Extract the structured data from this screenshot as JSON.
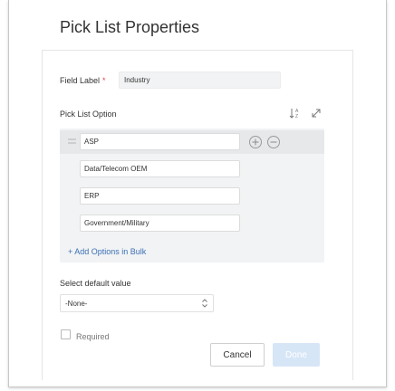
{
  "dialog": {
    "title": "Pick List Properties"
  },
  "field_label": {
    "label": "Field Label",
    "required_marker": "*",
    "value": "Industry"
  },
  "pick_list": {
    "label": "Pick List Option",
    "sort_icon": "sort-alpha-icon",
    "expand_icon": "expand-icon",
    "options": [
      {
        "value": "ASP"
      },
      {
        "value": "Data/Telecom OEM"
      },
      {
        "value": "ERP"
      },
      {
        "value": "Government/Military"
      }
    ],
    "add_bulk_label": "+ Add Options in Bulk"
  },
  "default_value": {
    "label": "Select default value",
    "selected": "-None-"
  },
  "required": {
    "label": "Required",
    "checked": false
  },
  "buttons": {
    "cancel": "Cancel",
    "done": "Done"
  },
  "colors": {
    "accent_link": "#3d6fb6",
    "done_disabled_bg": "#d7e6f7",
    "required_star": "#e0484b",
    "panel_bg": "#f1f3f4"
  }
}
